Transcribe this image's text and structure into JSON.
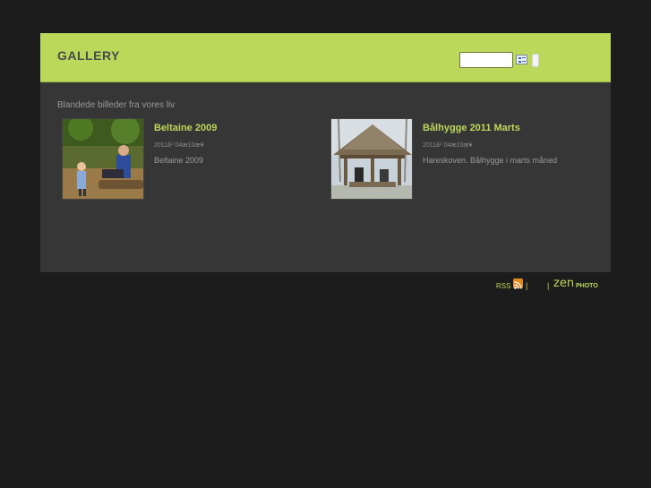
{
  "header": {
    "title": "GALLERY",
    "search_placeholder": ""
  },
  "main": {
    "description": "Blandede billeder fra vores liv",
    "albums": [
      {
        "title": "Beltaine 2009",
        "date": "2011å¹´04æ10æ¥",
        "description": "Beltaine 2009",
        "thumbnail": "children-in-forest"
      },
      {
        "title": "Bålhygge 2011 Marts",
        "date": "2011å¹´04æ10æ¥",
        "description": "Hareskoven. Bålhygge i marts måned",
        "thumbnail": "wooden-shelter"
      }
    ]
  },
  "footer": {
    "rss_label": "RSS",
    "separator": "|",
    "brand_zen": "zen",
    "brand_photo": "PHOTO"
  },
  "colors": {
    "accent": "#bcd85a",
    "background": "#1c1c1c",
    "panel": "#363636"
  }
}
